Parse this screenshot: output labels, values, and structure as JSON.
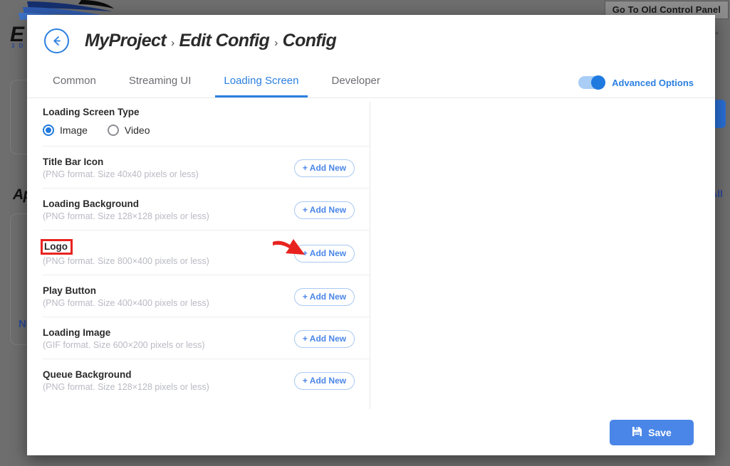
{
  "background": {
    "old_control_panel_button": "Go To Old Control Panel",
    "brand": "E",
    "brand_sub": "3 D",
    "apps_title": "Ap",
    "all_link": "All",
    "new_link": "N",
    "dots": "•••"
  },
  "modal": {
    "back_icon": "back-arrow-icon",
    "breadcrumb": {
      "items": [
        "MyProject",
        "Edit Config",
        "Config"
      ],
      "separator": "›"
    },
    "tabs": [
      {
        "label": "Common",
        "active": false
      },
      {
        "label": "Streaming UI",
        "active": false
      },
      {
        "label": "Loading Screen",
        "active": true
      },
      {
        "label": "Developer",
        "active": false
      }
    ],
    "advanced_options": {
      "label": "Advanced Options",
      "enabled": true
    },
    "loading_screen_type": {
      "title": "Loading Screen Type",
      "options": [
        {
          "label": "Image",
          "selected": true
        },
        {
          "label": "Video",
          "selected": false
        }
      ]
    },
    "assets": [
      {
        "name": "Title Bar Icon",
        "hint": "(PNG format. Size 40x40 pixels or less)",
        "button": "+ Add New",
        "highlighted": false
      },
      {
        "name": "Loading Background",
        "hint": "(PNG format. Size 128×128 pixels or less)",
        "button": "+ Add New",
        "highlighted": false
      },
      {
        "name": "Logo",
        "hint": "(PNG format. Size 800×400 pixels or less)",
        "button": "+ Add New",
        "highlighted": true
      },
      {
        "name": "Play Button",
        "hint": "(PNG format. Size 400×400 pixels or less)",
        "button": "+ Add New",
        "highlighted": false
      },
      {
        "name": "Loading Image",
        "hint": "(GIF format. Size 600×200 pixels or less)",
        "button": "+ Add New",
        "highlighted": false
      },
      {
        "name": "Queue Background",
        "hint": "(PNG format. Size 128×128 pixels or less)",
        "button": "+ Add New",
        "highlighted": false
      }
    ],
    "save_button": "Save"
  },
  "colors": {
    "accent_blue": "#2b7fe0",
    "button_blue": "#4a86e8",
    "annotation_red": "#e8231f",
    "hint_gray": "#b9bac4",
    "text_dark": "#2b2b2b"
  }
}
